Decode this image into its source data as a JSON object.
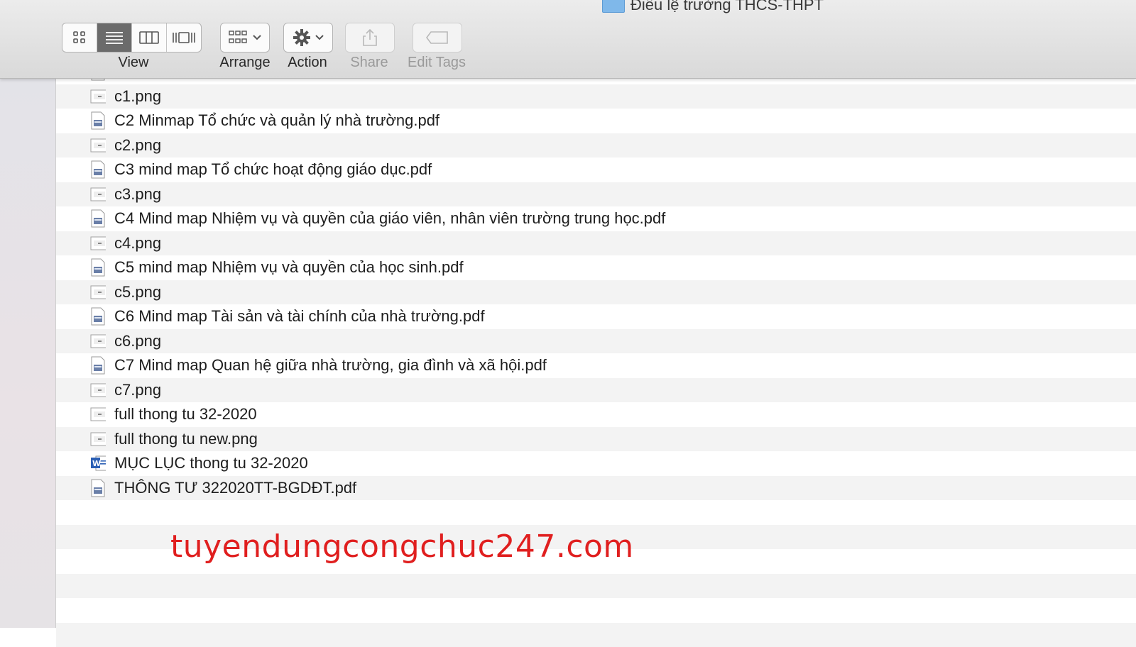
{
  "window": {
    "title": "Điều lệ trường THCS-THPT"
  },
  "toolbar": {
    "view_label": "View",
    "arrange_label": "Arrange",
    "action_label": "Action",
    "share_label": "Share",
    "edit_tags_label": "Edit Tags"
  },
  "files": [
    {
      "name": "",
      "icon": "pdf-icon"
    },
    {
      "name": "c1.png",
      "icon": "image-icon"
    },
    {
      "name": "C2 Minmap Tổ chức và quản lý nhà trường.pdf",
      "icon": "pdf-icon"
    },
    {
      "name": "c2.png",
      "icon": "image-icon"
    },
    {
      "name": "C3 mind map Tổ chức hoạt động giáo dục.pdf",
      "icon": "pdf-icon"
    },
    {
      "name": "c3.png",
      "icon": "image-icon"
    },
    {
      "name": "C4 Mind map Nhiệm vụ và quyền của giáo viên, nhân viên trường trung học.pdf",
      "icon": "pdf-icon"
    },
    {
      "name": "c4.png",
      "icon": "image-icon"
    },
    {
      "name": "C5 mind map Nhiệm vụ và quyền của học sinh.pdf",
      "icon": "pdf-icon"
    },
    {
      "name": "c5.png",
      "icon": "image-icon"
    },
    {
      "name": "C6 Mind map Tài sản và tài chính của nhà trường.pdf",
      "icon": "pdf-icon"
    },
    {
      "name": "c6.png",
      "icon": "image-icon"
    },
    {
      "name": "C7 Mind map Quan hệ giữa nhà trường, gia đình và xã hội.pdf",
      "icon": "pdf-icon"
    },
    {
      "name": "c7.png",
      "icon": "image-icon"
    },
    {
      "name": "full thong tu 32-2020",
      "icon": "image-icon"
    },
    {
      "name": "full thong tu new.png",
      "icon": "image-icon"
    },
    {
      "name": "MỤC LỤC thong tu 32-2020",
      "icon": "word-icon"
    },
    {
      "name": "THÔNG TƯ 322020TT-BGDĐT.pdf",
      "icon": "pdf-icon"
    },
    {
      "name": "",
      "icon": ""
    },
    {
      "name": "",
      "icon": ""
    },
    {
      "name": "",
      "icon": ""
    },
    {
      "name": "",
      "icon": ""
    },
    {
      "name": "",
      "icon": ""
    },
    {
      "name": "",
      "icon": ""
    }
  ],
  "watermark": "tuyendungcongchuc247.com",
  "colors": {
    "watermark": "#e01f1f",
    "folder": "#7fb8ea",
    "active_segment": "#6b6b6b"
  }
}
